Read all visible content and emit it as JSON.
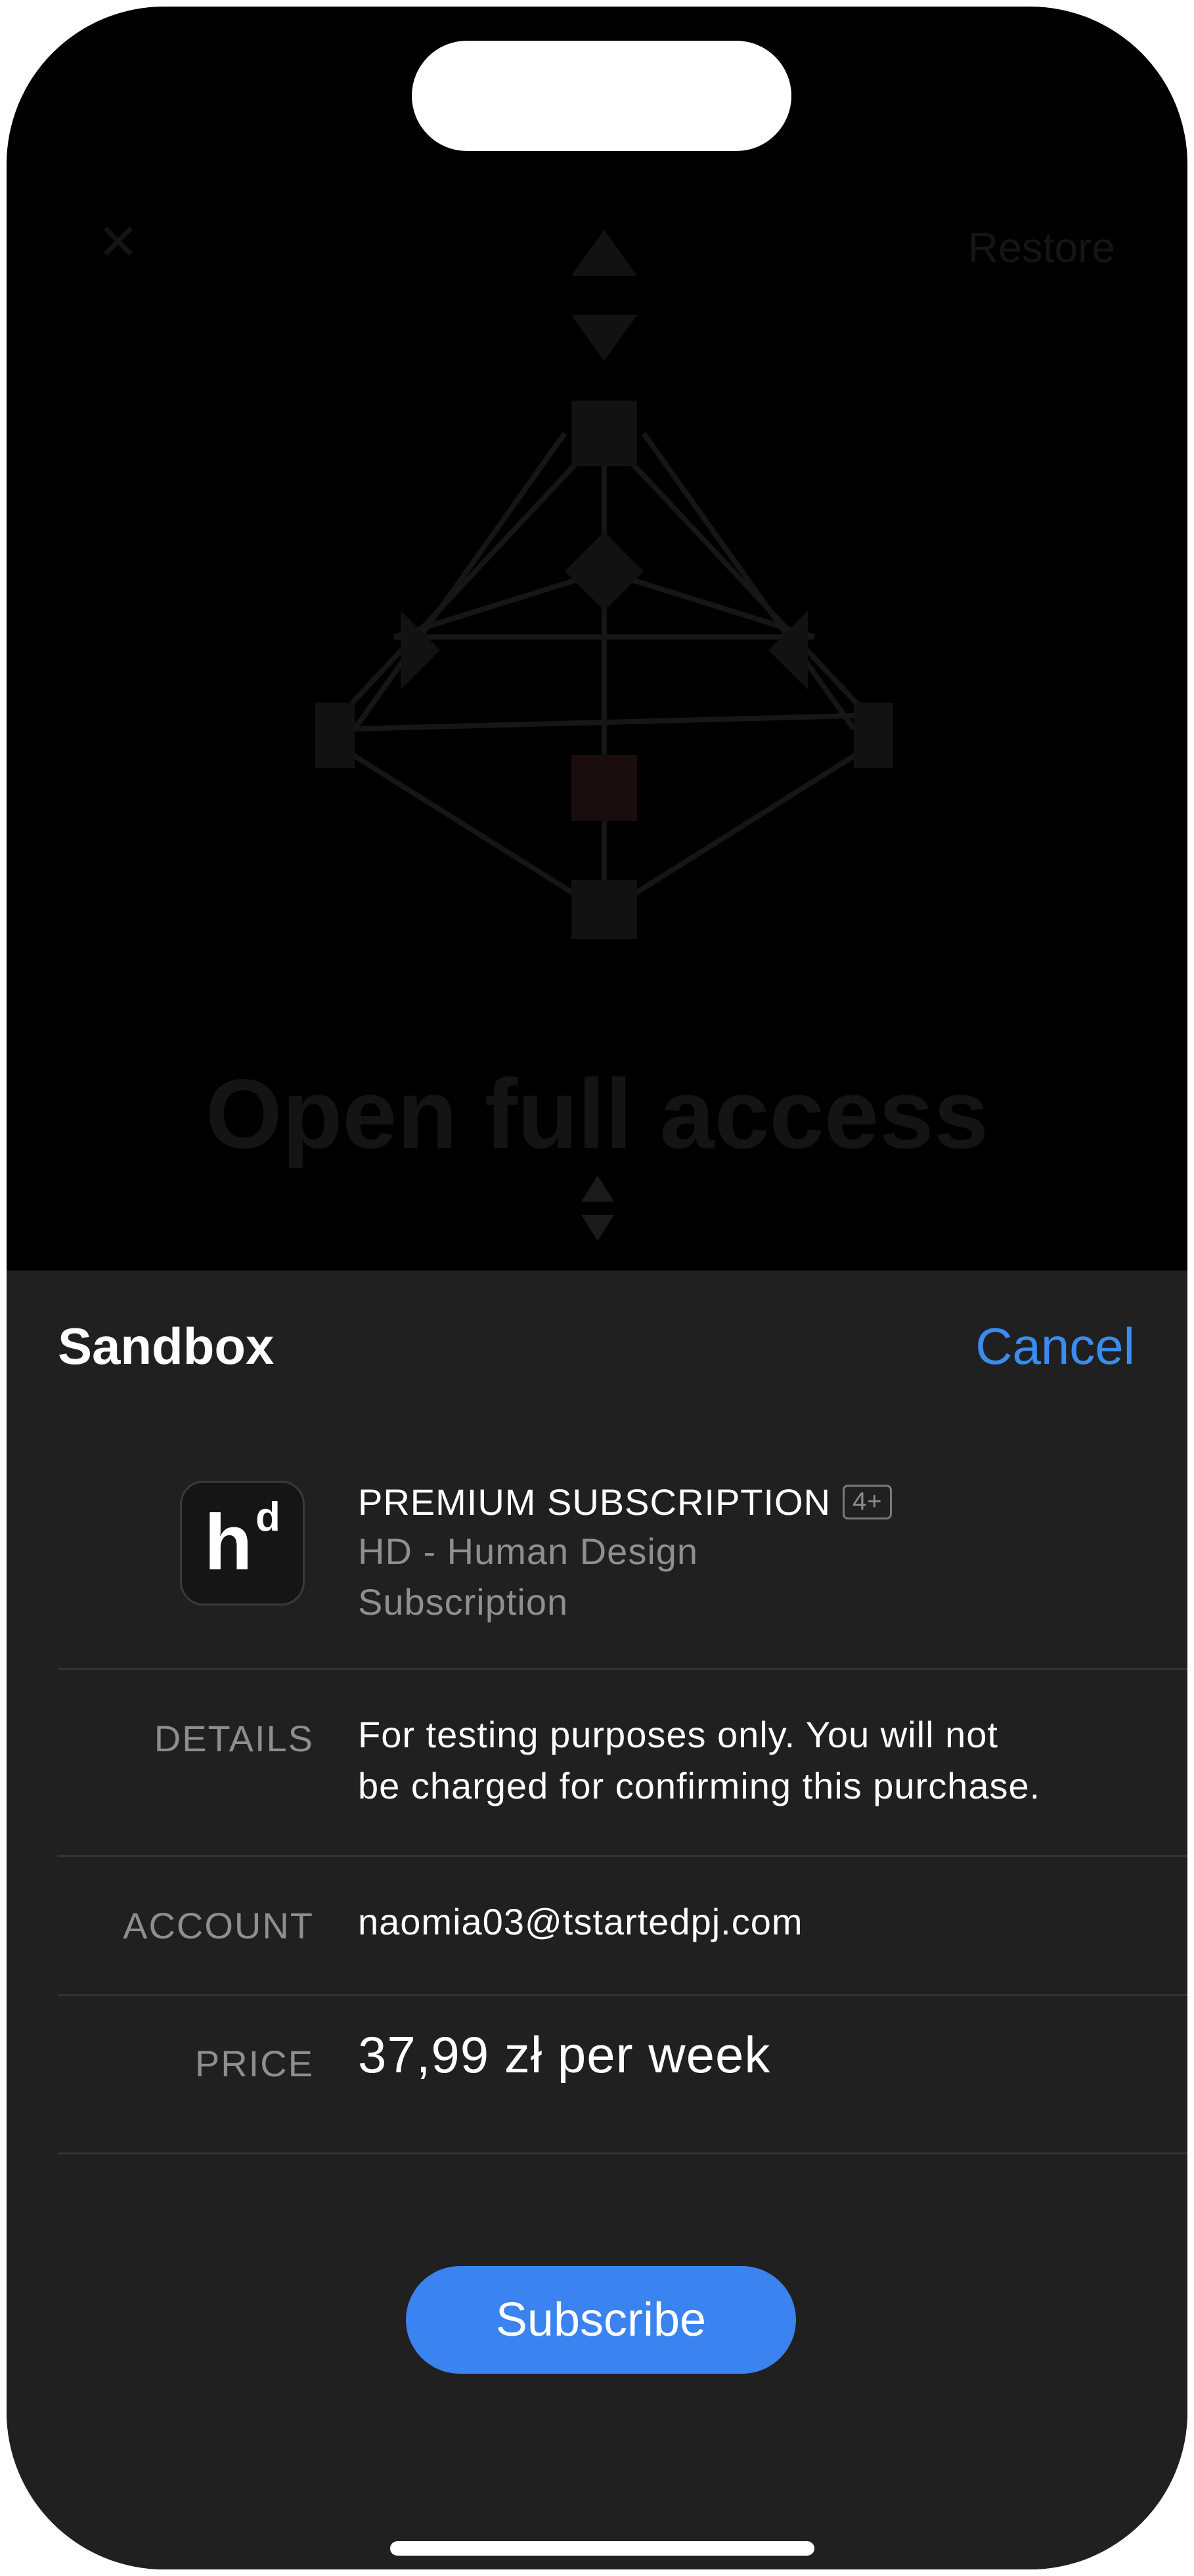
{
  "background_app": {
    "restore_label": "Restore",
    "title": "Open full access"
  },
  "sheet": {
    "title": "Sandbox",
    "cancel_label": "Cancel",
    "product": {
      "name": "PREMIUM SUBSCRIPTION",
      "age_rating": "4+",
      "app_name": "HD - Human Design",
      "type": "Subscription",
      "icon": "hd-app-icon"
    },
    "details": {
      "label": "DETAILS",
      "line1": "For testing purposes only. You will not",
      "line2": "be charged for confirming this purchase."
    },
    "account": {
      "label": "ACCOUNT",
      "value": "naomia03@tstartedpj.com"
    },
    "price": {
      "label": "PRICE",
      "value": "37,99 zł per week"
    },
    "subscribe_label": "Subscribe"
  },
  "colors": {
    "accent": "#3b8cf0",
    "sheet_background": "#202020",
    "background": "#000000"
  }
}
